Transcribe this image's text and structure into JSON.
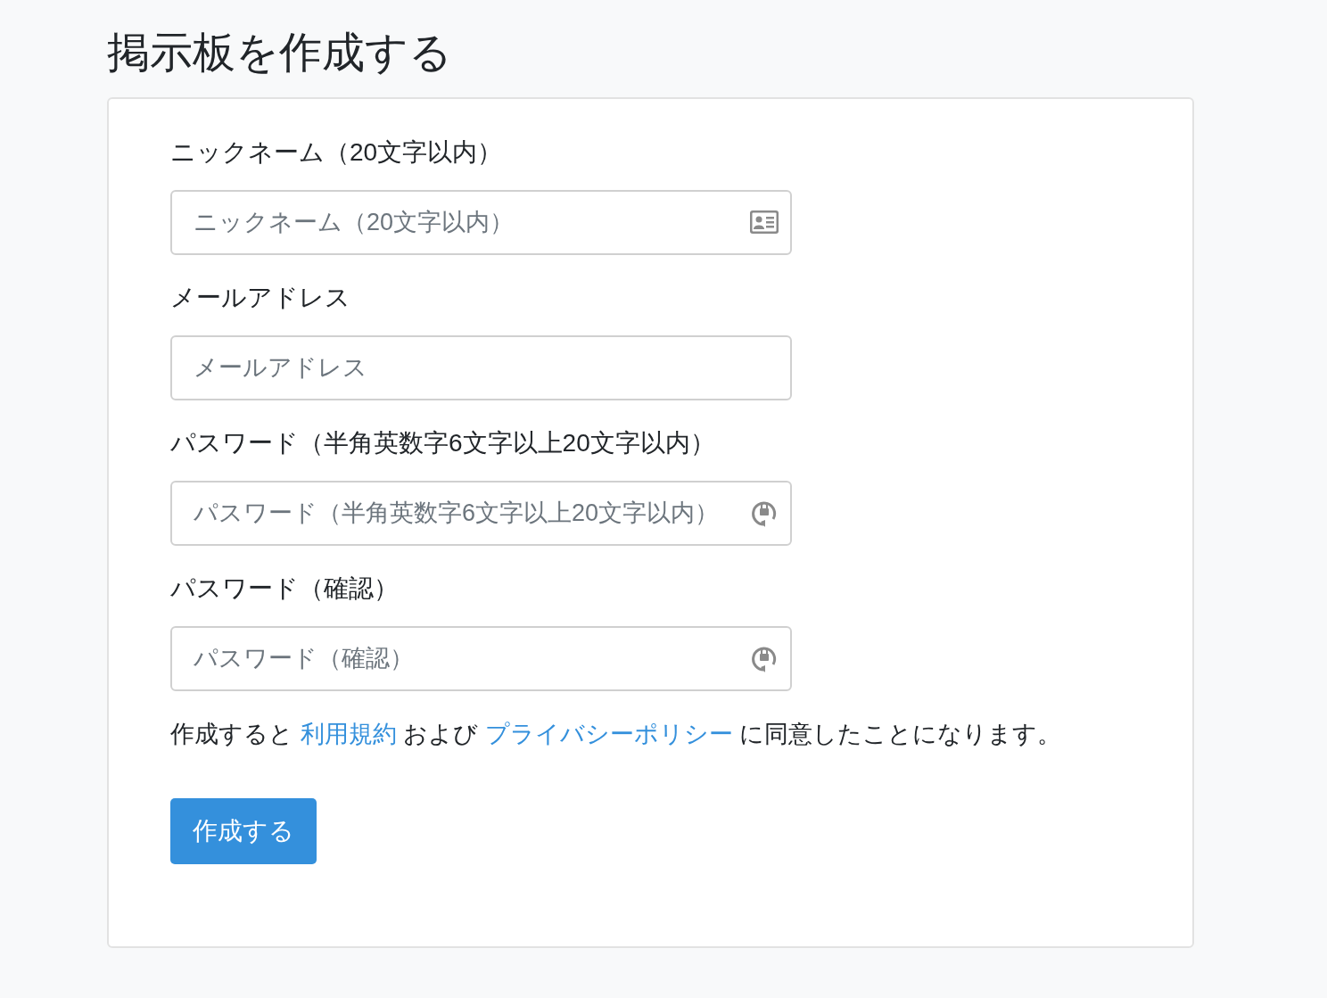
{
  "page": {
    "title": "掲示板を作成する"
  },
  "fields": [
    {
      "label": "ニックネーム（20文字以内）",
      "placeholder": "ニックネーム（20文字以内）",
      "kind": "card"
    },
    {
      "label": "メールアドレス",
      "placeholder": "メールアドレス",
      "kind": "plain"
    },
    {
      "label": "パスワード（半角英数字6文字以上20文字以内）",
      "placeholder": "パスワード（半角英数字6文字以上20文字以内）",
      "kind": "password"
    },
    {
      "label": "パスワード（確認）",
      "placeholder": "パスワード（確認）",
      "kind": "password"
    }
  ],
  "terms": {
    "before": "作成すると",
    "link1": "利用規約",
    "middle": "および",
    "link2": "プライバシーポリシー",
    "after": "に同意したことになります。"
  },
  "submit": "作成する"
}
